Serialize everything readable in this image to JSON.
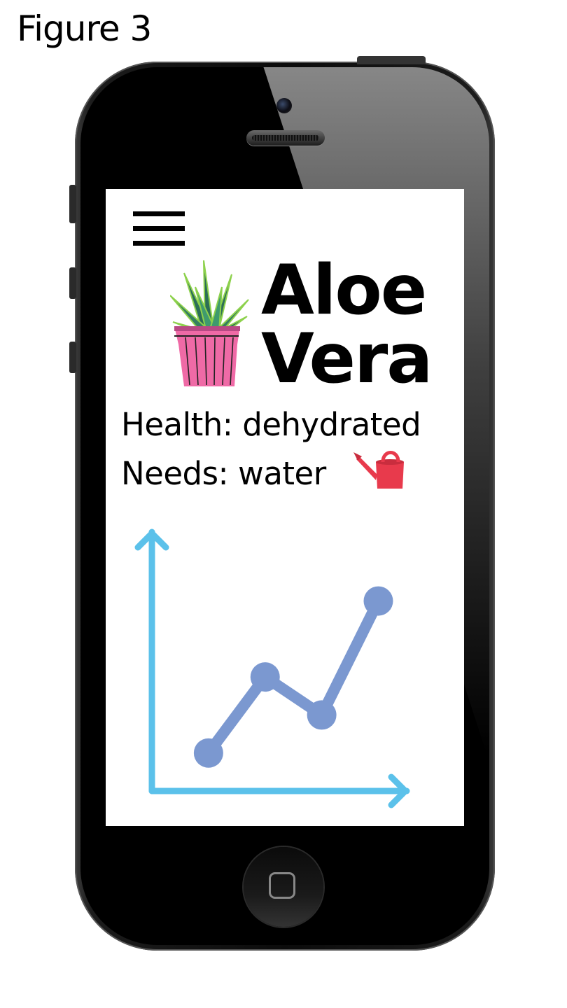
{
  "caption": "Figure 3",
  "app": {
    "title_line1": "Aloe",
    "title_line2": "Vera",
    "health_label": "Health:",
    "health_value": "dehydrated",
    "needs_label": "Needs:",
    "needs_value": "water"
  },
  "icons": {
    "menu": "hamburger-menu-icon",
    "plant": "potted-aloe-icon",
    "needs": "watering-can-icon"
  },
  "colors": {
    "axis": "#5bc1ea",
    "series": "#7b98d0",
    "pot": "#ef6aa6",
    "leaf_dark": "#2c6e57",
    "leaf_light": "#8dd14c",
    "watering_can": "#e83a4c"
  },
  "chart_data": {
    "type": "line",
    "x": [
      1,
      2,
      3,
      4
    ],
    "series": [
      {
        "values": [
          1,
          3,
          2,
          5
        ]
      }
    ],
    "xlabel": "",
    "ylabel": "",
    "ylim": [
      0,
      7
    ],
    "xlim": [
      0,
      4.6
    ],
    "grid": false,
    "axes_arrows": true
  }
}
